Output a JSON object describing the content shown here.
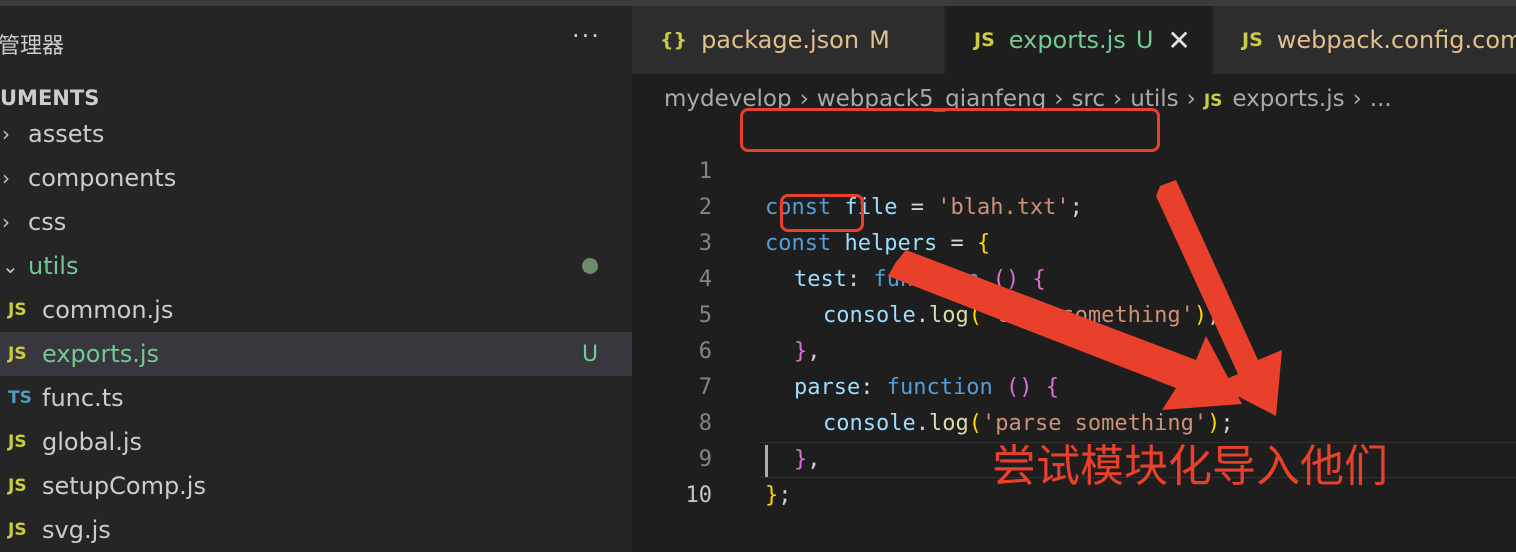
{
  "sidebar": {
    "title": "管理器",
    "more": "···",
    "section": "UMENTS",
    "items": [
      {
        "chevron": "›",
        "label": "assets"
      },
      {
        "chevron": "›",
        "label": "components"
      },
      {
        "chevron": "›",
        "label": "css"
      },
      {
        "chevron": "⌄",
        "label": "utils"
      },
      {
        "icon": "JS",
        "label": "common.js"
      },
      {
        "icon": "JS",
        "label": "exports.js",
        "badge": "U"
      },
      {
        "icon": "TS",
        "label": "func.ts"
      },
      {
        "icon": "JS",
        "label": "global.js"
      },
      {
        "icon": "JS",
        "label": "setupComp.js"
      },
      {
        "icon": "JS",
        "label": "svg.js"
      }
    ]
  },
  "tabs": [
    {
      "icon": "{}",
      "name": "package.json",
      "status": "M"
    },
    {
      "icon": "JS",
      "name": "exports.js",
      "status": "U",
      "close": "✕"
    },
    {
      "icon": "JS",
      "name": "webpack.config.com"
    }
  ],
  "breadcrumb": {
    "parts": [
      "mydevelop",
      "webpack5_qianfeng",
      "src",
      "utils"
    ],
    "file_icon": "JS",
    "file": "exports.js",
    "tail": "..."
  },
  "code": {
    "line_numbers": [
      "1",
      "2",
      "3",
      "4",
      "5",
      "6",
      "7",
      "8",
      "9",
      "10"
    ],
    "l1": {
      "kw": "const",
      "var": "file",
      "op": " = ",
      "str": "'blah.txt'",
      "end": ";"
    },
    "l2": {
      "kw": "const",
      "var": "helpers",
      "op": " = ",
      "br": "{"
    },
    "l3": {
      "key": "test",
      "colon": ": ",
      "kw": "function",
      "sp": " ",
      "paren": "()",
      "sp2": " ",
      "br": "{"
    },
    "l4": {
      "obj": "console",
      "dot": ".",
      "fn": "log",
      "p1": "(",
      "str": "'test something'",
      "p2": ")",
      "end": ";"
    },
    "l5": {
      "br": "}",
      "end": ","
    },
    "l6": {
      "key": "parse",
      "colon": ": ",
      "kw": "function",
      "sp": " ",
      "paren": "()",
      "sp2": " ",
      "br": "{"
    },
    "l7": {
      "obj": "console",
      "dot": ".",
      "fn": "log",
      "p1": "(",
      "str": "'parse something'",
      "p2": ")",
      "end": ";"
    },
    "l8": {
      "br": "}",
      "end": ","
    },
    "l9": {
      "br": "}",
      "end": ";"
    }
  },
  "annotation": {
    "text": "尝试模块化导入他们",
    "color": "#e8402a"
  }
}
